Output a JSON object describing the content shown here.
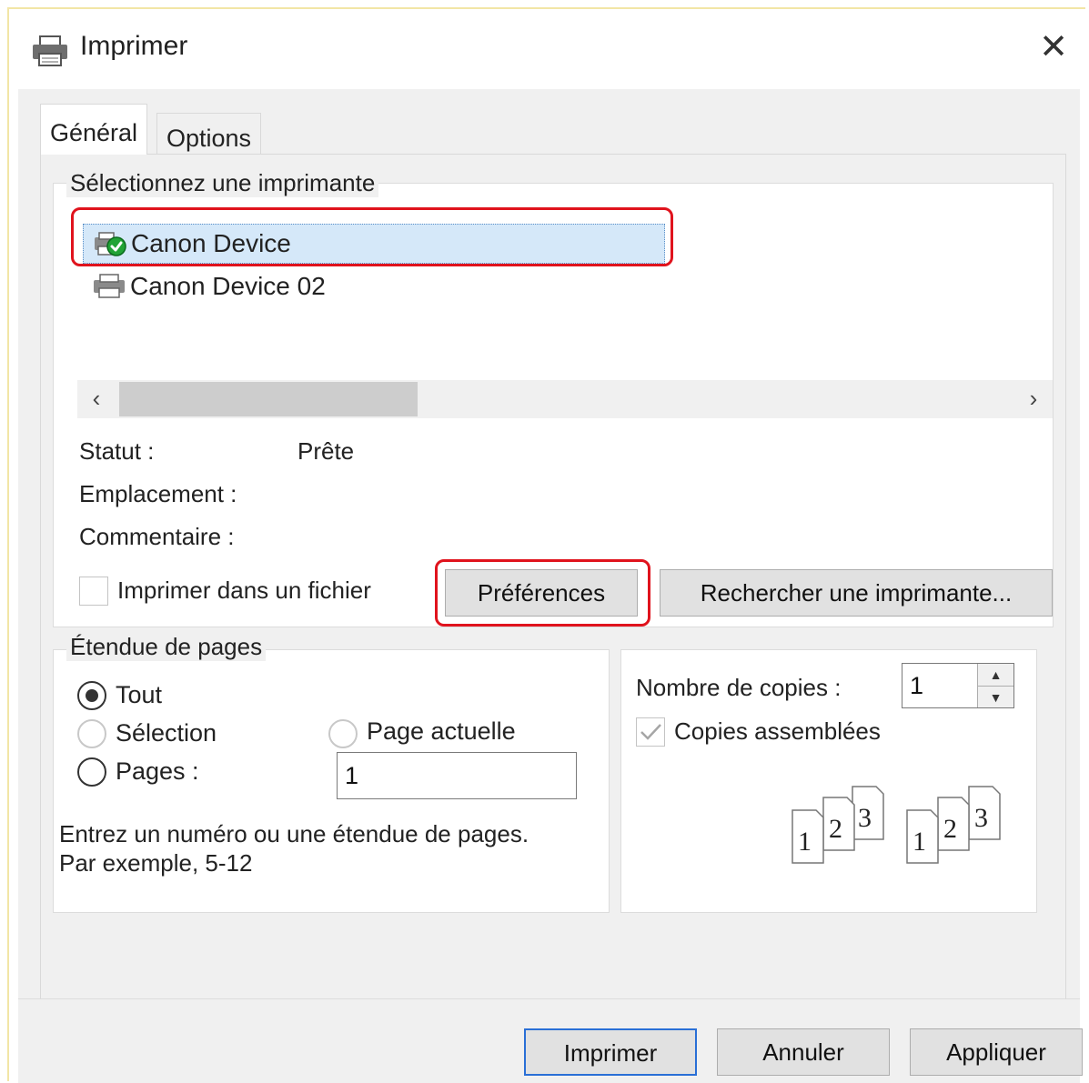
{
  "window": {
    "title": "Imprimer",
    "close_label": "✕"
  },
  "tabs": [
    {
      "label": "Général",
      "active": true
    },
    {
      "label": "Options",
      "active": false
    }
  ],
  "printer_group": {
    "label": "Sélectionnez une imprimante",
    "printers": [
      {
        "name": "Canon Device",
        "selected": true
      },
      {
        "name": "Canon Device 02",
        "selected": false
      }
    ],
    "scroll_left": "‹",
    "scroll_right": "›",
    "status_label": "Statut :",
    "status_value": "Prête",
    "location_label": "Emplacement :",
    "comment_label": "Commentaire :",
    "print_to_file_label": "Imprimer dans un fichier",
    "preferences_button": "Préférences",
    "find_printer_button": "Rechercher une imprimante..."
  },
  "page_range": {
    "label": "Étendue de pages",
    "all_label": "Tout",
    "selection_label": "Sélection",
    "current_page_label": "Page actuelle",
    "pages_label": "Pages :",
    "pages_value": "1",
    "hint_line1": "Entrez un numéro ou une étendue de pages.",
    "hint_line2": "Par exemple, 5-12"
  },
  "copies": {
    "label": "Nombre de copies :",
    "value": "1",
    "collate_label": "Copies assemblées",
    "collate_checked": true
  },
  "footer": {
    "print_button": "Imprimer",
    "cancel_button": "Annuler",
    "apply_button": "Appliquer"
  },
  "colors": {
    "highlight_border": "#e0131d",
    "selection_bg": "#d5e8f9",
    "default_button_border": "#2a6fd6",
    "status_green": "#22a336"
  }
}
